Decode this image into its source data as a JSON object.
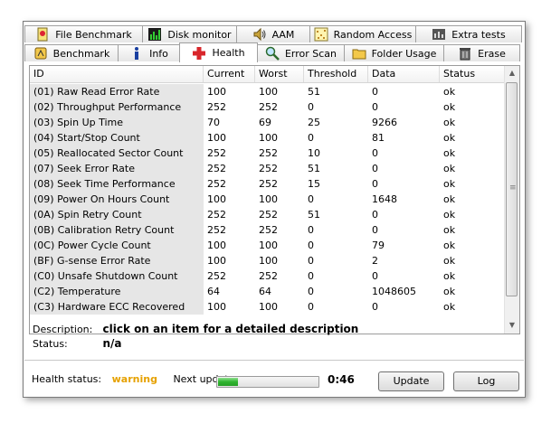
{
  "tabs_row1": [
    {
      "label": "File Benchmark",
      "icon": "file-benchmark-icon"
    },
    {
      "label": "Disk monitor",
      "icon": "disk-monitor-icon"
    },
    {
      "label": "AAM",
      "icon": "speaker-icon"
    },
    {
      "label": "Random Access",
      "icon": "random-access-icon"
    },
    {
      "label": "Extra tests",
      "icon": "extra-tests-icon"
    }
  ],
  "tabs_row2": [
    {
      "label": "Benchmark",
      "icon": "benchmark-icon"
    },
    {
      "label": "Info",
      "icon": "info-icon"
    },
    {
      "label": "Health",
      "icon": "health-cross-icon",
      "active": true
    },
    {
      "label": "Error Scan",
      "icon": "magnifier-icon"
    },
    {
      "label": "Folder Usage",
      "icon": "folder-icon"
    },
    {
      "label": "Erase",
      "icon": "trash-icon"
    }
  ],
  "table": {
    "columns": [
      "ID",
      "Current",
      "Worst",
      "Threshold",
      "Data",
      "Status"
    ],
    "rows": [
      [
        "(01) Raw Read Error Rate",
        "100",
        "100",
        "51",
        "0",
        "ok"
      ],
      [
        "(02) Throughput Performance",
        "252",
        "252",
        "0",
        "0",
        "ok"
      ],
      [
        "(03) Spin Up Time",
        "70",
        "69",
        "25",
        "9266",
        "ok"
      ],
      [
        "(04) Start/Stop Count",
        "100",
        "100",
        "0",
        "81",
        "ok"
      ],
      [
        "(05) Reallocated Sector Count",
        "252",
        "252",
        "10",
        "0",
        "ok"
      ],
      [
        "(07) Seek Error Rate",
        "252",
        "252",
        "51",
        "0",
        "ok"
      ],
      [
        "(08) Seek Time Performance",
        "252",
        "252",
        "15",
        "0",
        "ok"
      ],
      [
        "(09) Power On Hours Count",
        "100",
        "100",
        "0",
        "1648",
        "ok"
      ],
      [
        "(0A) Spin Retry Count",
        "252",
        "252",
        "51",
        "0",
        "ok"
      ],
      [
        "(0B) Calibration Retry Count",
        "252",
        "252",
        "0",
        "0",
        "ok"
      ],
      [
        "(0C) Power Cycle Count",
        "100",
        "100",
        "0",
        "79",
        "ok"
      ],
      [
        "(BF) G-sense Error Rate",
        "100",
        "100",
        "0",
        "2",
        "ok"
      ],
      [
        "(C0) Unsafe Shutdown Count",
        "252",
        "252",
        "0",
        "0",
        "ok"
      ],
      [
        "(C2) Temperature",
        "64",
        "64",
        "0",
        "1048605",
        "ok"
      ],
      [
        "(C3) Hardware ECC Recovered",
        "100",
        "100",
        "0",
        "0",
        "ok"
      ]
    ]
  },
  "description": {
    "label": "Description:",
    "value": "click on an item for a detailed description",
    "status_label": "Status:",
    "status_value": "n/a"
  },
  "footer": {
    "health_status_label": "Health status:",
    "health_status_value": "warning",
    "next_update_label": "Next update:",
    "progress_fraction": 0.2,
    "timer": "0:46",
    "update_button": "Update",
    "log_button": "Log"
  },
  "colors": {
    "warning": "#e6a100",
    "progress_fill": "#2fb42f"
  }
}
